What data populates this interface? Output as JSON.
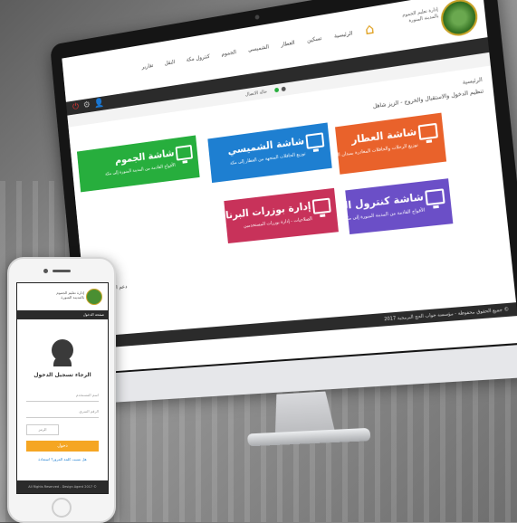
{
  "desktop": {
    "header": {
      "logo_text": "إدارة تعليم الجموم\nبالمدينة المنورة",
      "nav": [
        "الرئيسية",
        "تسكين",
        "العطار",
        "الشميسي",
        "الجموم",
        "كنترول مكة",
        "النقل",
        "تقارير"
      ]
    },
    "status_text": "حالة الاتصال",
    "breadcrumb": "الرئيسية",
    "subtitle": "تنظيم الدخول والاستقبال والخروج - الزيز شاهل",
    "tiles": [
      {
        "title": "شاشة الجموم",
        "desc": "الأفواج القادمة من المدينة المنورة إلى مكة",
        "color": "#27ae3d"
      },
      {
        "title": "شاشة الشميسي",
        "desc": "توزيع الحافلات المتجهة من العطار إلى مكة",
        "color": "#1e7fd1"
      },
      {
        "title": "شاشة العطار",
        "desc": "توزيع الرحلات والحافلات المغادرة بميدان الحجاج",
        "color": "#e9622b"
      },
      {
        "title": "إدارة بوزرات البرنامج",
        "desc": "الصلاحيات - إدارة بوزرات المستخدمين",
        "color": "#c8325a"
      },
      {
        "title": "شاشة كنترول النقل",
        "desc": "الأفواج القادمة من المدينة المنورة إلى مكة",
        "color": "#6b4fc7"
      }
    ],
    "chat_text": "دعم المرور الإتصال بنا",
    "footer_text": "جميع الحقوق محفوظة - مؤسسة جواب الحج البرمجية 2017 ©"
  },
  "phone": {
    "logo_text": "إدارة تعليم الجموم\nبالمدينة المنورة",
    "bar_text": "صفحة الدخول",
    "welcome": "الرجاء تسجيل الدخول",
    "username_placeholder": "اسم المستخدم",
    "password_placeholder": "الرقم السري",
    "code_placeholder": "الرمز",
    "login_label": "دخول",
    "forgot_label": "هل نسيت كلمة المرور؟ استعادة",
    "footer_text": "All Rights Reserved - Design Agent 2017 ©"
  },
  "colors": {
    "accent": "#f5a623",
    "dark_bar": "#2b2b2b"
  }
}
